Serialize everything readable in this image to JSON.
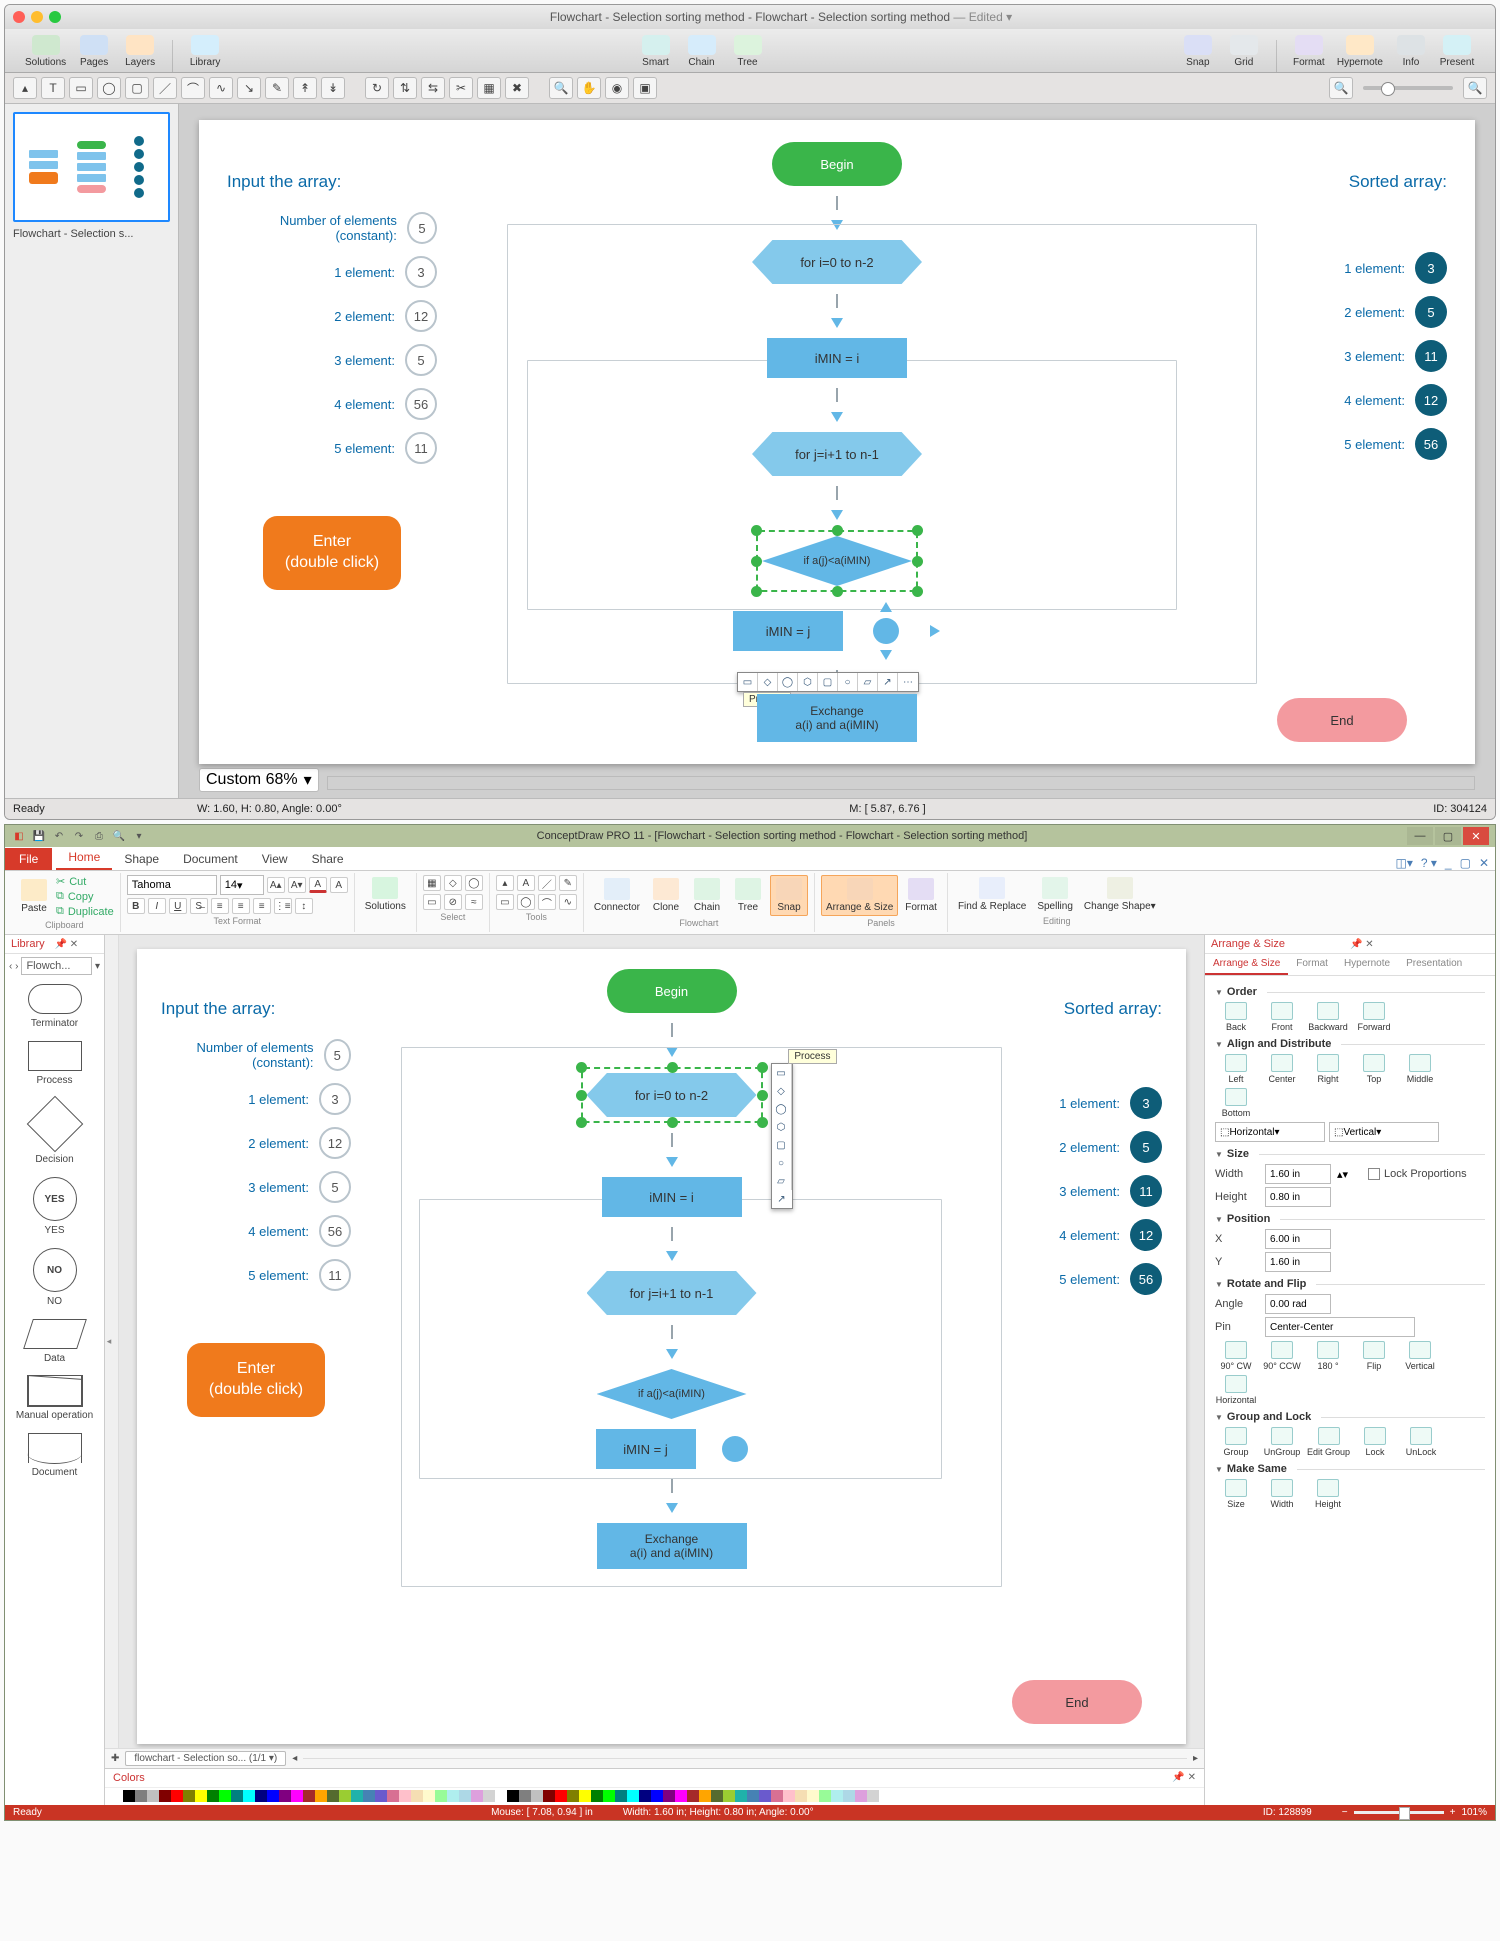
{
  "mac": {
    "title": "Flowchart - Selection sorting method - Flowchart - Selection sorting method",
    "edited": "— Edited ▾",
    "toolbar": [
      {
        "label": "Solutions",
        "color": "#4caf50"
      },
      {
        "label": "Pages",
        "color": "#2196f3"
      },
      {
        "label": "Layers",
        "color": "#ff9800"
      },
      {
        "label": "Library",
        "color": "#03a9f4"
      },
      {
        "label": "Smart",
        "color": "#4db6ac"
      },
      {
        "label": "Chain",
        "color": "#29b6f6"
      },
      {
        "label": "Tree",
        "color": "#66bb6a"
      },
      {
        "label": "Snap",
        "color": "#5c6bc0"
      },
      {
        "label": "Grid",
        "color": "#90a4ae"
      },
      {
        "label": "Format",
        "color": "#7e57c2"
      },
      {
        "label": "Hypernote",
        "color": "#ffa726"
      },
      {
        "label": "Info",
        "color": "#546e7a"
      },
      {
        "label": "Present",
        "color": "#26c6da"
      }
    ],
    "thumb_label": "Flowchart - Selection s...",
    "zoom": "Custom 68%",
    "footer_wh": "W: 1.60, H: 0.80, Angle: 0.00°",
    "footer_m": "M: [ 5.87, 6.76 ]",
    "footer_id": "ID: 304124",
    "ready": "Ready",
    "process_tip": "Process"
  },
  "win": {
    "title": "ConceptDraw PRO 11 - [Flowchart - Selection sorting method - Flowchart - Selection sorting method]",
    "tabs": [
      "Home",
      "Shape",
      "Document",
      "View",
      "Share"
    ],
    "file": "File",
    "clipboard": {
      "paste": "Paste",
      "cut": "Cut",
      "copy": "Copy",
      "dup": "Duplicate",
      "grp": "Clipboard"
    },
    "font": {
      "name": "Tahoma",
      "size": "14",
      "grp": "Text Format"
    },
    "groups": {
      "solutions": "Solutions",
      "select": "Select",
      "tools": "Tools",
      "connector": "Connector",
      "clone": "Clone",
      "chain": "Chain",
      "tree": "Tree",
      "snap": "Snap",
      "arrange": "Arrange & Size",
      "format": "Format",
      "find": "Find & Replace",
      "spell": "Spelling",
      "change": "Change Shape▾",
      "flow_grp": "Flowchart",
      "panels_grp": "Panels",
      "edit_grp": "Editing"
    },
    "library": {
      "hdr": "Library",
      "tab": "Flowch...",
      "items": [
        "Terminator",
        "Process",
        "Decision",
        "YES",
        "NO",
        "Data",
        "Manual operation",
        "Document"
      ]
    },
    "page_tab": "flowchart - Selection so... (1/1  ▾)",
    "colors_hdr": "Colors",
    "status": {
      "ready": "Ready",
      "mouse": "Mouse: [ 7.08, 0.94 ] in",
      "wh": "Width: 1.60 in;  Height: 0.80 in;  Angle: 0.00°",
      "id": "ID: 128899",
      "zoom": "101%"
    },
    "process_tip": "Process",
    "rp": {
      "hdr": "Arrange & Size",
      "tabs": [
        "Arrange & Size",
        "Format",
        "Hypernote",
        "Presentation"
      ],
      "order": {
        "hdr": "Order",
        "btns": [
          "Back",
          "Front",
          "Backward",
          "Forward"
        ]
      },
      "align": {
        "hdr": "Align and Distribute",
        "btns": [
          "Left",
          "Center",
          "Right",
          "Top",
          "Middle",
          "Bottom"
        ],
        "horiz": "Horizontal",
        "vert": "Vertical"
      },
      "size": {
        "hdr": "Size",
        "w": "Width",
        "wv": "1.60 in",
        "h": "Height",
        "hv": "0.80 in",
        "lock": "Lock Proportions"
      },
      "pos": {
        "hdr": "Position",
        "x": "X",
        "xv": "6.00 in",
        "y": "Y",
        "yv": "1.60 in"
      },
      "rot": {
        "hdr": "Rotate and Flip",
        "a": "Angle",
        "av": "0.00 rad",
        "p": "Pin",
        "pv": "Center-Center",
        "btns": [
          "90° CW",
          "90° CCW",
          "180 °",
          "Flip",
          "Vertical",
          "Horizontal"
        ]
      },
      "grp": {
        "hdr": "Group and Lock",
        "btns": [
          "Group",
          "UnGroup",
          "Edit Group",
          "Lock",
          "UnLock"
        ]
      },
      "same": {
        "hdr": "Make Same",
        "btns": [
          "Size",
          "Width",
          "Height"
        ]
      }
    }
  },
  "flow": {
    "input_title": "Input the array:",
    "sorted_title": "Sorted array:",
    "const_label": "Number of elements (constant):",
    "const_val": "5",
    "inputs": [
      {
        "lbl": "1 element:",
        "v": "3"
      },
      {
        "lbl": "2 element:",
        "v": "12"
      },
      {
        "lbl": "3 element:",
        "v": "5"
      },
      {
        "lbl": "4 element:",
        "v": "56"
      },
      {
        "lbl": "5 element:",
        "v": "11"
      }
    ],
    "outputs": [
      {
        "lbl": "1 element:",
        "v": "3"
      },
      {
        "lbl": "2 element:",
        "v": "5"
      },
      {
        "lbl": "3 element:",
        "v": "11"
      },
      {
        "lbl": "4 element:",
        "v": "12"
      },
      {
        "lbl": "5 element:",
        "v": "56"
      }
    ],
    "enter": "Enter\n(double click)",
    "nodes": {
      "begin": "Begin",
      "for1": "for i=0 to n-2",
      "min_i": "iMIN = i",
      "for2": "for j=i+1 to n-1",
      "cond": "if a(j)<a(iMIN)",
      "min_j": "iMIN = j",
      "exch": "Exchange\na(i) and a(iMIN)",
      "end": "End"
    }
  }
}
